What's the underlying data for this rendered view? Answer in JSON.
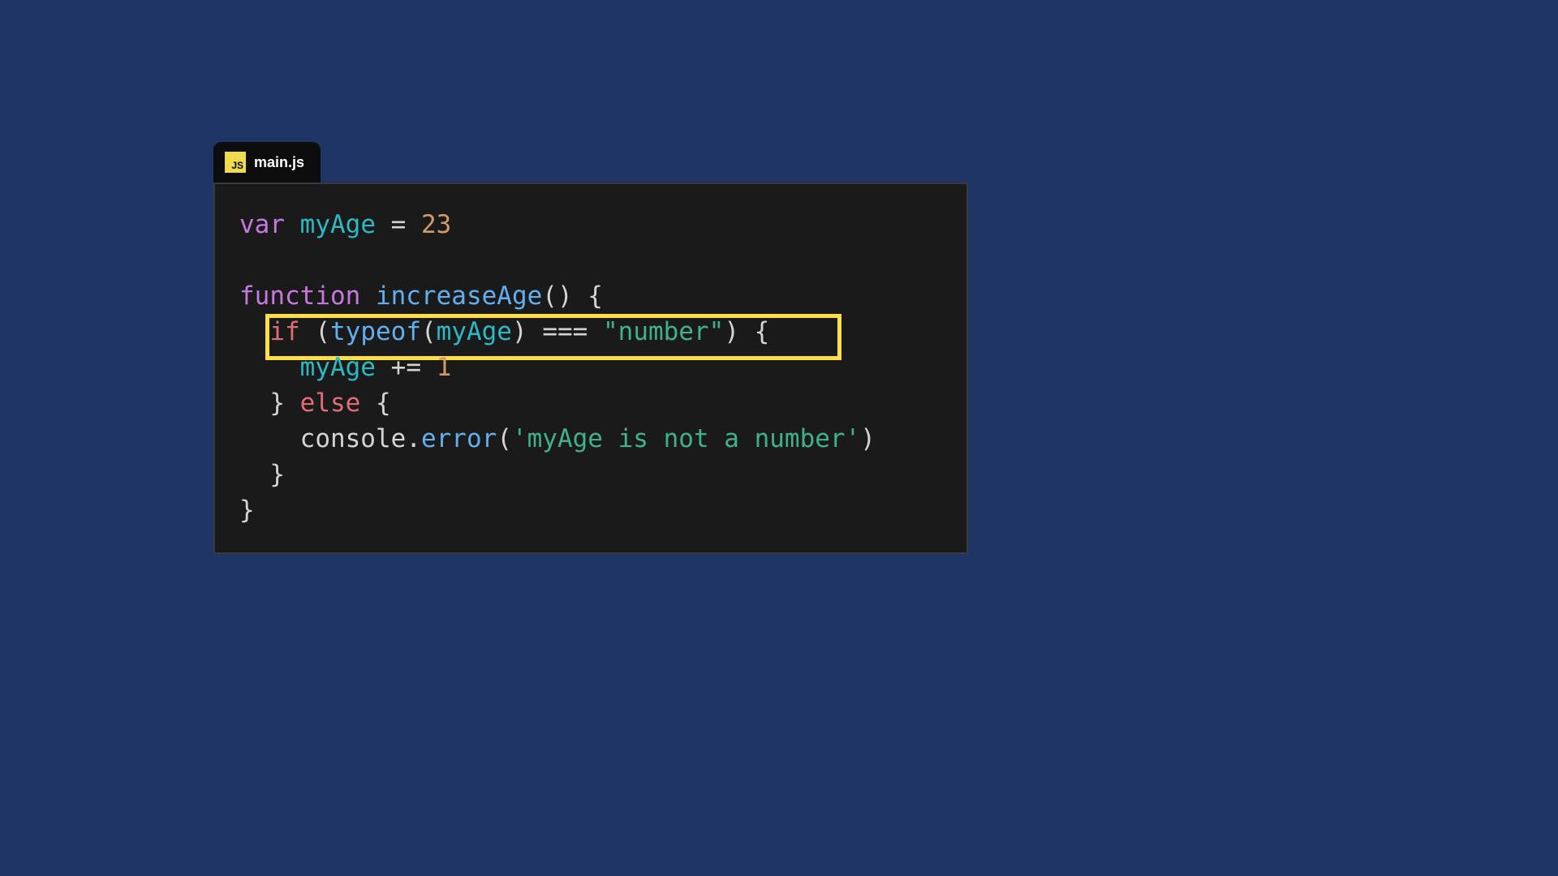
{
  "tab": {
    "icon_label": "JS",
    "filename": "main.js"
  },
  "code": {
    "line1": {
      "var": "var",
      "name": "myAge",
      "eq": "=",
      "val": "23"
    },
    "line3": {
      "fn": "function",
      "name": "increaseAge",
      "parens": "()",
      "brace": "{"
    },
    "line4": {
      "ifkw": "if",
      "open": "(",
      "typeof": "typeof",
      "open2": "(",
      "arg": "myAge",
      "close2": ")",
      "op": "===",
      "str": "\"number\"",
      "close": ")",
      "brace": "{"
    },
    "line5": {
      "name": "myAge",
      "op": "+=",
      "val": "1"
    },
    "line6": {
      "close": "}",
      "elsekw": "else",
      "brace": "{"
    },
    "line7": {
      "obj": "console",
      "dot": ".",
      "method": "error",
      "open": "(",
      "str": "'myAge is not a number'",
      "close": ")"
    },
    "line8": {
      "close": "}"
    },
    "line9": {
      "close": "}"
    }
  }
}
